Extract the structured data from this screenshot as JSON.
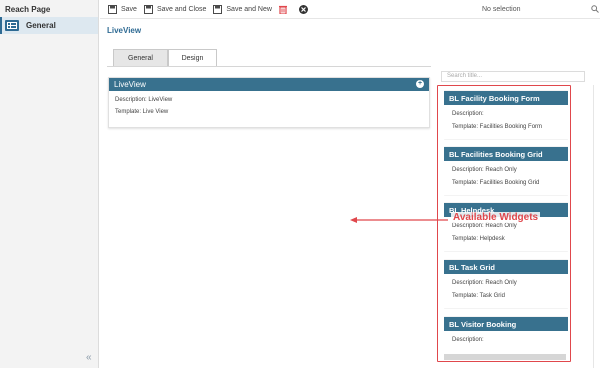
{
  "sidebar": {
    "title": "Reach Page",
    "items": [
      {
        "label": "General",
        "icon": "grid-icon"
      }
    ],
    "collapse_icon": "«"
  },
  "toolbar": {
    "save": "Save",
    "save_close": "Save and Close",
    "save_new": "Save and New",
    "selection": "No selection"
  },
  "page": {
    "link": "LiveView"
  },
  "tabs": [
    {
      "label": "General"
    },
    {
      "label": "Design"
    }
  ],
  "card": {
    "title": "LiveView",
    "description": "Description: LiveView",
    "template": "Template: Live View"
  },
  "widgets_panel": {
    "search_placeholder": "Search title...",
    "widgets": [
      {
        "title": "BL Facility Booking Form",
        "description": "Description:",
        "template": "Template: Facilities Booking Form"
      },
      {
        "title": "BL Facilities Booking Grid",
        "description": "Description: Reach Only",
        "template": "Template: Facilities Booking Grid"
      },
      {
        "title": "BL Helpdesk",
        "description": "Description: Reach Only",
        "template": "Template: Helpdesk"
      },
      {
        "title": "BL Task Grid",
        "description": "Description: Reach Only",
        "template": "Template: Task Grid"
      },
      {
        "title": "BL Visitor Booking",
        "description": "Description:",
        "template": ""
      }
    ]
  },
  "annotation": {
    "label": "Available Widgets"
  },
  "colors": {
    "accent": "#38718e",
    "highlight": "#e0474c",
    "link": "#2e6a93"
  }
}
